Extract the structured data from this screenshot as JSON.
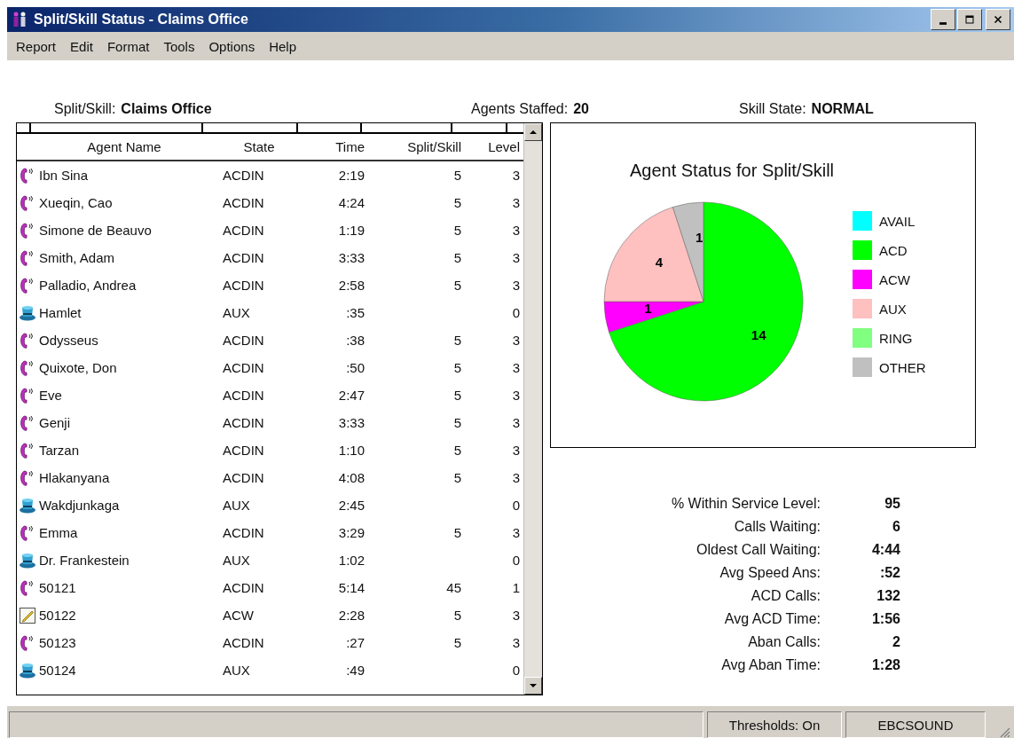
{
  "window": {
    "title": "Split/Skill Status - Claims Office"
  },
  "menu": [
    "Report",
    "Edit",
    "Format",
    "Tools",
    "Options",
    "Help"
  ],
  "header": [
    {
      "label": "Split/Skill:",
      "value": "Claims Office"
    },
    {
      "label": "Agents Staffed:",
      "value": "20"
    },
    {
      "label": "Skill State:",
      "value": "NORMAL"
    }
  ],
  "table": {
    "columns": [
      "Agent Name",
      "State",
      "Time",
      "Split/Skill",
      "Level"
    ],
    "rows": [
      {
        "kind": "acd",
        "name": "Ibn Sina",
        "state": "ACDIN",
        "time": "2:19",
        "split_skill": "5",
        "level": "3"
      },
      {
        "kind": "acd",
        "name": "Xueqin, Cao",
        "state": "ACDIN",
        "time": "4:24",
        "split_skill": "5",
        "level": "3"
      },
      {
        "kind": "acd",
        "name": "Simone de Beauvo",
        "state": "ACDIN",
        "time": "1:19",
        "split_skill": "5",
        "level": "3"
      },
      {
        "kind": "acd",
        "name": "Smith, Adam",
        "state": "ACDIN",
        "time": "3:33",
        "split_skill": "5",
        "level": "3"
      },
      {
        "kind": "acd",
        "name": "Palladio, Andrea",
        "state": "ACDIN",
        "time": "2:58",
        "split_skill": "5",
        "level": "3"
      },
      {
        "kind": "aux",
        "name": "Hamlet",
        "state": "AUX",
        "time": ":35",
        "level": "0"
      },
      {
        "kind": "acd",
        "name": "Odysseus",
        "state": "ACDIN",
        "time": ":38",
        "split_skill": "5",
        "level": "3"
      },
      {
        "kind": "acd",
        "name": "Quixote, Don",
        "state": "ACDIN",
        "time": ":50",
        "split_skill": "5",
        "level": "3"
      },
      {
        "kind": "acd",
        "name": "Eve",
        "state": "ACDIN",
        "time": "2:47",
        "split_skill": "5",
        "level": "3"
      },
      {
        "kind": "acd",
        "name": "Genji",
        "state": "ACDIN",
        "time": "3:33",
        "split_skill": "5",
        "level": "3"
      },
      {
        "kind": "acd",
        "name": "Tarzan",
        "state": "ACDIN",
        "time": "1:10",
        "split_skill": "5",
        "level": "3"
      },
      {
        "kind": "acd",
        "name": "Hlakanyana",
        "state": "ACDIN",
        "time": "4:08",
        "split_skill": "5",
        "level": "3"
      },
      {
        "kind": "aux",
        "name": "Wakdjunkaga",
        "state": "AUX",
        "time": "2:45",
        "level": "0"
      },
      {
        "kind": "acd",
        "name": "Emma",
        "state": "ACDIN",
        "time": "3:29",
        "split_skill": "5",
        "level": "3"
      },
      {
        "kind": "aux",
        "name": "Dr. Frankestein",
        "state": "AUX",
        "time": "1:02",
        "level": "0"
      },
      {
        "kind": "acd",
        "name": "50121",
        "state": "ACDIN",
        "time": "5:14",
        "split_skill": "45",
        "level": "1"
      },
      {
        "kind": "acw",
        "name": "50122",
        "state": "ACW",
        "time": "2:28",
        "split_skill": "5",
        "level": "3"
      },
      {
        "kind": "acd",
        "name": "50123",
        "state": "ACDIN",
        "time": ":27",
        "split_skill": "5",
        "level": "3"
      },
      {
        "kind": "aux",
        "name": "50124",
        "state": "AUX",
        "time": ":49",
        "level": "0"
      }
    ]
  },
  "chart": {
    "chart_data": {
      "type": "pie",
      "title": "Agent Status for Split/Skill",
      "categories": [
        "AVAIL",
        "ACD",
        "ACW",
        "AUX",
        "RING",
        "OTHER"
      ],
      "values": [
        0,
        14,
        1,
        4,
        0,
        1
      ],
      "data_labels": true,
      "legend": "right"
    },
    "slice_colors": [
      {
        "color": "#00ffff"
      },
      {
        "color": "#00ff00"
      },
      {
        "color": "#ff00ff"
      },
      {
        "color": "#ffc0c0"
      },
      {
        "color": "#80ff80"
      },
      {
        "color": "#c0c0c0"
      }
    ]
  },
  "stats": [
    {
      "label": "% Within Service Level:",
      "value": "95"
    },
    {
      "label": "Calls Waiting:",
      "value": "6"
    },
    {
      "label": "Oldest Call Waiting:",
      "value": "4:44"
    },
    {
      "label": "Avg Speed Ans:",
      "value": ":52"
    },
    {
      "label": "ACD Calls:",
      "value": "132"
    },
    {
      "label": "Avg ACD Time:",
      "value": "1:56"
    },
    {
      "label": "Aban Calls:",
      "value": "2"
    },
    {
      "label": "Avg Aban Time:",
      "value": "1:28"
    }
  ],
  "status_bar": [
    "Thresholds: On",
    "EBCSOUND"
  ]
}
